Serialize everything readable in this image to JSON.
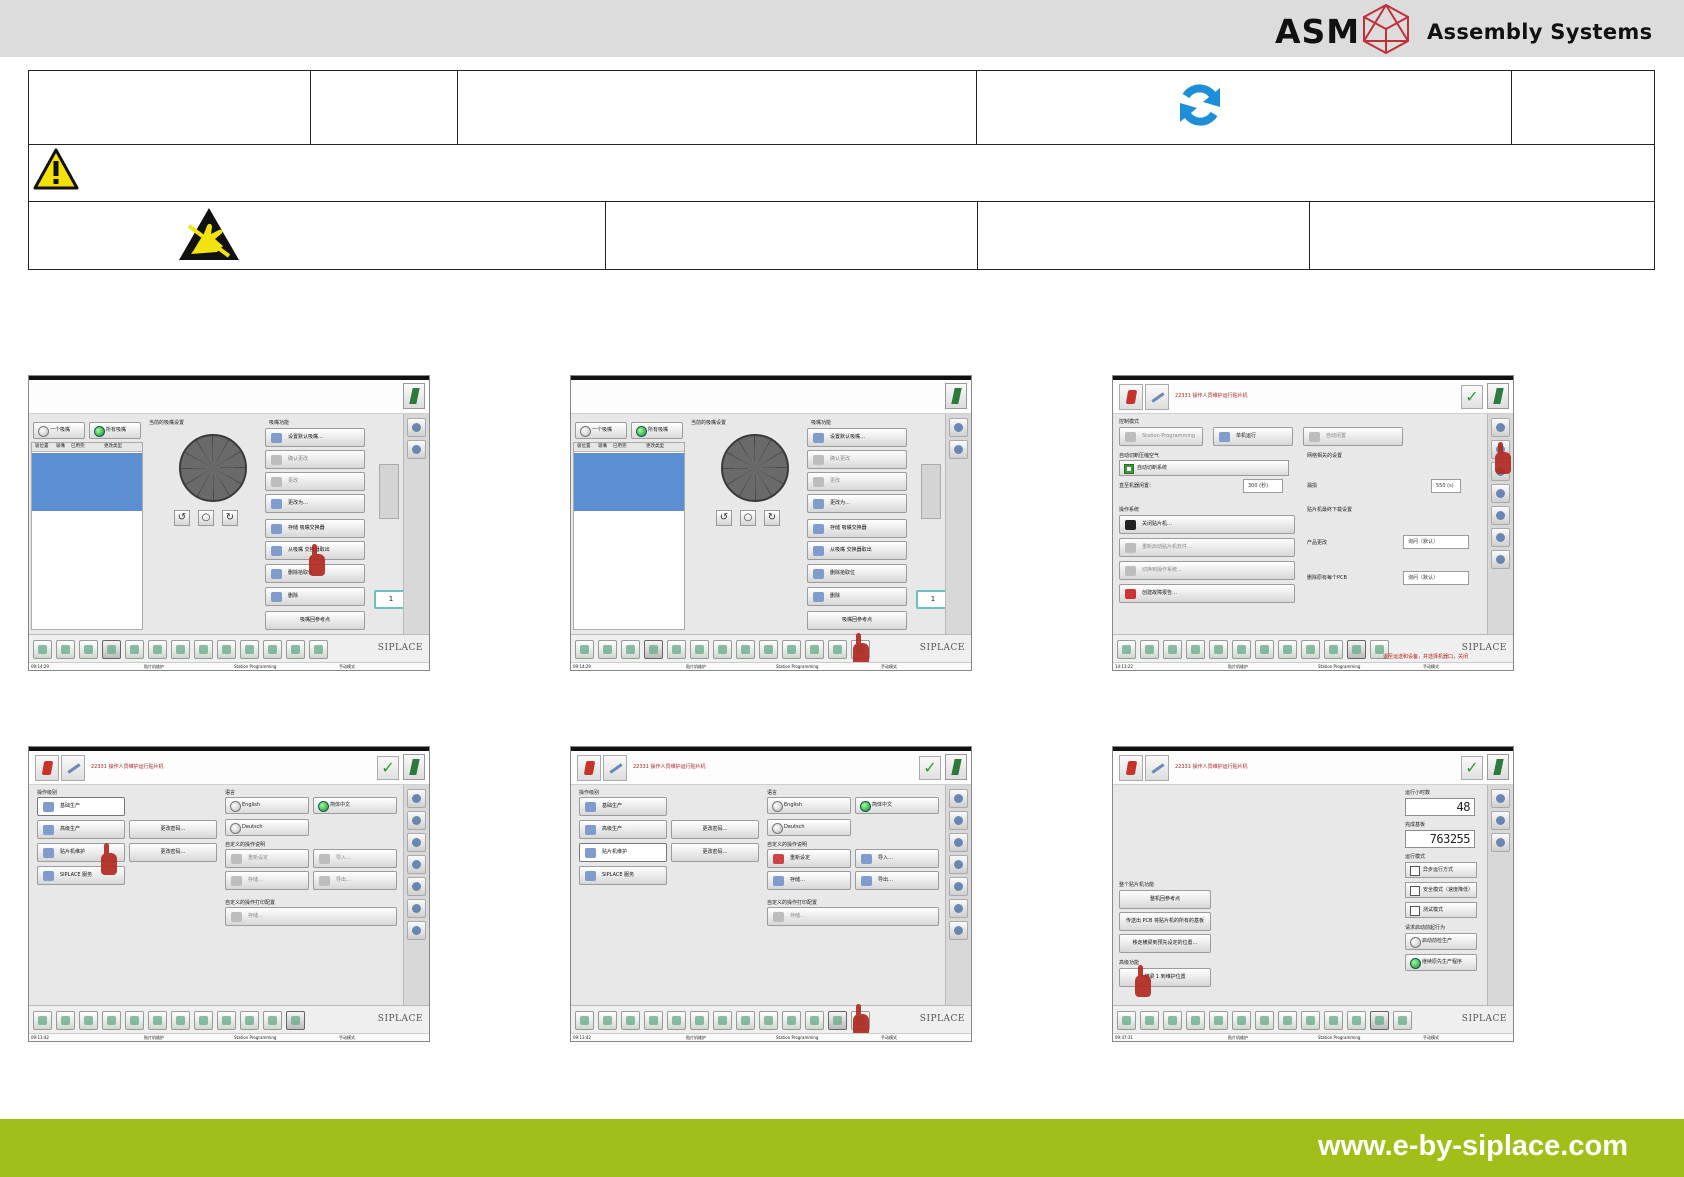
{
  "brand": {
    "name": "ASM",
    "subtitle": "Assembly Systems",
    "accent_color": "#c0303a",
    "footer_color": "#a0c019"
  },
  "header_icons": {
    "refresh": "refresh-icon",
    "warning": "warning-triangle-icon",
    "esd": "esd-sensitive-icon"
  },
  "footer": {
    "url": "www.e-by-siplace.com"
  },
  "shots": {
    "common": {
      "siplace": "SIPLACE",
      "page_title": "22331 操作人员维护运行贴片机",
      "status_user": "贴片机维护",
      "status_station": "Station Programming",
      "status_mode": "手动模式"
    },
    "s1": {
      "time": "09:14:29",
      "radio_one": "一个吸嘴",
      "radio_all": "所有吸嘴",
      "col_pos": "吸位置",
      "col_nozzle": "吸嘴",
      "col_used": "已用完",
      "col_type": "更改类型",
      "current_label": "当前的吸嘴设置",
      "functions_label": "吸嘴功能",
      "btn_set_defaults": "设置默认吸嘴…",
      "btn_confirm": "确认更改",
      "btn_change": "更改",
      "btn_change_to": "更改为…",
      "btn_store": "存储\n吸嘴交换器",
      "btn_load": "从吸嘴\n交换器取出",
      "btn_delete_pickup": "删除拾取位",
      "btn_delete": "删除",
      "btn_ref": "吸嘴回参考点",
      "counter": "1"
    },
    "s3": {
      "time": "14:13:22",
      "label_control": "控制模式",
      "btn_station_programming": "Station Programming",
      "btn_single_run": "单机运行",
      "btn_idle": "自动闲置",
      "label_auto_vacuum": "自动切断压缩空气",
      "check_auto_close": "自动切断系统",
      "label_delay": "直至机器闲置：",
      "delay_value": "300 (秒)",
      "label_net": "网络相关的设置",
      "label_vacuum": "漏损",
      "vacuum_value": "550 (s)",
      "label_os": "操作系统",
      "btn_shutdown": "关闭贴片机…",
      "btn_restart": "重新启动贴片机软件…",
      "btn_switch": "切换到操作系统…",
      "btn_diagnose": "创建故障报告…",
      "label_default": "贴片机最终下载设置",
      "label_product": "产品更改",
      "product_value": "询问（默认）",
      "label_pcb": "删除原有每个PCB",
      "pcb_value": "询问（默认）",
      "tooltip": "退至运送和设备，并选择机器口，关闭"
    },
    "s4": {
      "time": "09:13:42",
      "label_op_level": "操作级别",
      "btn_basic": "基础生产",
      "btn_advanced": "高级生产",
      "btn_maint": "贴片机维护",
      "btn_service": "SIPLACE 服务",
      "btn_pw1": "更改密码…",
      "btn_pw2": "更改密码…",
      "label_lang": "语言",
      "lang_en": "English",
      "lang_zh": "简体中文",
      "lang_de": "Deutsch",
      "label_ui": "自定义的操作说明",
      "btn_reset": "重新设定",
      "btn_import": "导入…",
      "btn_save": "存储…",
      "btn_export": "导出…",
      "label_print": "自定义的操作打印配置",
      "btn_print": "存储…"
    },
    "s6": {
      "time": "09:47:31",
      "label_hours": "运行小时数",
      "hours_value": "48",
      "label_boards": "完成基板",
      "boards_value": "763255",
      "label_run_mode": "运行模式",
      "mode_a": "异步运行方式",
      "mode_b": "安全模式（速度降低）",
      "mode_c": "测试模式",
      "label_restart": "请求启动前起行为",
      "restart_a": "启动前检生产",
      "restart_b": "继续原先生产程序",
      "label_machine": "整个贴片机功能",
      "btn_home": "整机回参考点",
      "btn_remove_pcb": "传送出 PCB 将贴片机的所有的基板",
      "btn_move_gantry": "移走横梁到预先设定的位置…",
      "label_special": "高级功能",
      "btn_maint_mode": "横梁 1 到维护位置"
    }
  }
}
